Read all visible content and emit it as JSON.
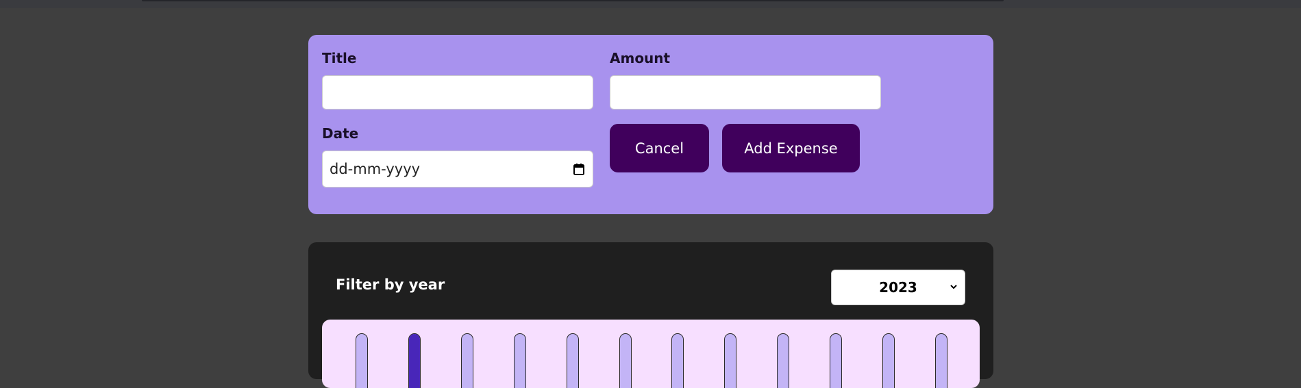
{
  "form": {
    "title_label": "Title",
    "title_value": "",
    "amount_label": "Amount",
    "amount_value": "",
    "date_label": "Date",
    "date_placeholder": "dd-mm-yyyy",
    "cancel_label": "Cancel",
    "submit_label": "Add Expense"
  },
  "filter": {
    "label": "Filter by year",
    "selected_year": "2023"
  },
  "chart_data": {
    "type": "bar",
    "categories": [],
    "values": [
      0,
      1,
      0,
      0,
      0,
      0,
      0,
      0,
      0,
      0,
      0,
      0
    ]
  },
  "colors": {
    "page_background": "#3f3f3f",
    "form_background": "#a892ee",
    "button_background": "#40005c",
    "filter_background": "#1f1f1f",
    "chart_background": "#f7dfff",
    "bar_empty": "#c3b4f6",
    "bar_fill": "#4826b9"
  }
}
